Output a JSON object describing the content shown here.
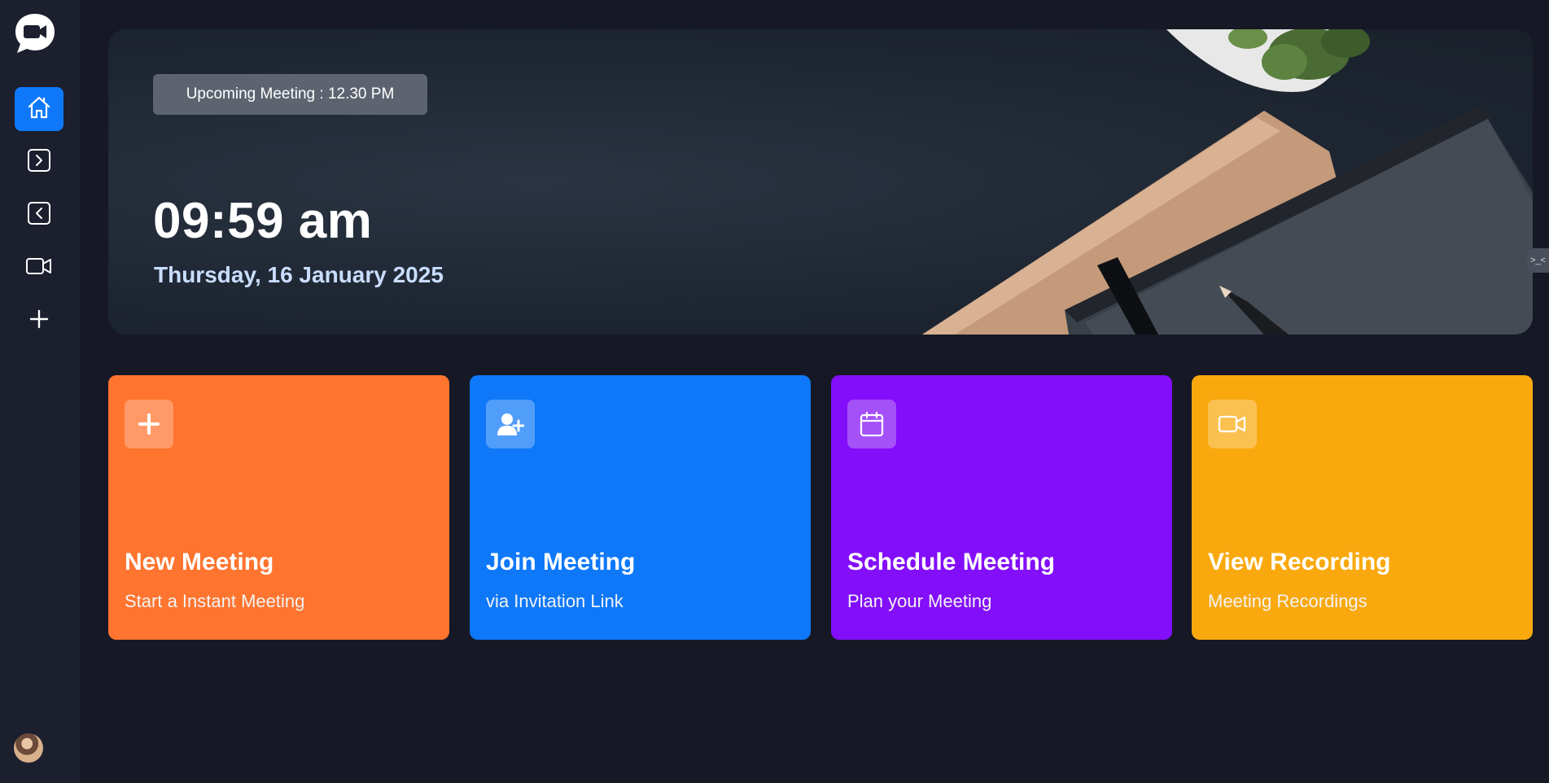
{
  "sidebar": {
    "logo_icon": "video-chat-logo-icon",
    "items": [
      {
        "id": "home",
        "icon": "home-icon",
        "active": true
      },
      {
        "id": "upcoming",
        "icon": "chevron-right-box-icon",
        "active": false
      },
      {
        "id": "previous",
        "icon": "chevron-left-box-icon",
        "active": false
      },
      {
        "id": "recordings",
        "icon": "video-camera-icon",
        "active": false
      },
      {
        "id": "personal-room",
        "icon": "plus-icon",
        "active": false
      }
    ],
    "accent": "#0e78f9"
  },
  "hero": {
    "upcoming_label": "Upcoming Meeting : 12.30 PM",
    "time": "09:59 am",
    "date": "Thursday, 16 January 2025"
  },
  "cards": [
    {
      "title": "New Meeting",
      "subtitle": "Start a Instant Meeting",
      "icon": "plus-icon",
      "color": "#ff742e"
    },
    {
      "title": "Join Meeting",
      "subtitle": "via Invitation Link",
      "icon": "user-plus-icon",
      "color": "#0e78f9"
    },
    {
      "title": "Schedule Meeting",
      "subtitle": "Plan your Meeting",
      "icon": "calendar-icon",
      "color": "#830ef9"
    },
    {
      "title": "View Recording",
      "subtitle": "Meeting Recordings",
      "icon": "video-camera-icon",
      "color": "#f9a90e"
    }
  ]
}
